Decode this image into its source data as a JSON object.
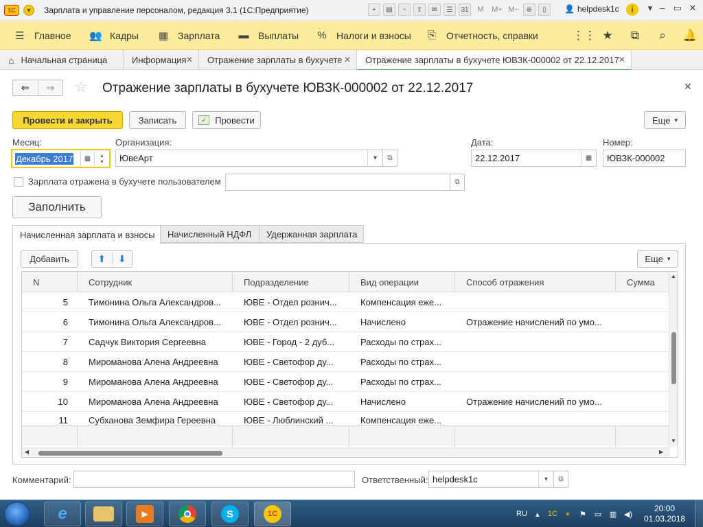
{
  "window": {
    "title": "Зарплата и управление персоналом, редакция 3.1 (1С:Предприятие)",
    "user": "helpdesk1c",
    "toolbar_text": [
      "M",
      "M+",
      "M−"
    ]
  },
  "sections": [
    {
      "label": "Главное",
      "icon": "hamburger-icon"
    },
    {
      "label": "Кадры",
      "icon": "people-icon"
    },
    {
      "label": "Зарплата",
      "icon": "calculator-icon"
    },
    {
      "label": "Выплаты",
      "icon": "wallet-icon"
    },
    {
      "label": "Налоги и взносы",
      "icon": "percent-icon"
    },
    {
      "label": "Отчетность, справки",
      "icon": "report-icon"
    }
  ],
  "open_tabs": [
    {
      "label": "Начальная страница",
      "icon": "home-icon"
    },
    {
      "label": "Информация"
    },
    {
      "label": "Отражение зарплаты в бухучете"
    },
    {
      "label": "Отражение зарплаты в бухучете ЮВЗК-000002 от 22.12.2017"
    }
  ],
  "document": {
    "title": "Отражение зарплаты в бухучете ЮВЗК-000002 от 22.12.2017",
    "buttons": {
      "post_close": "Провести и закрыть",
      "save": "Записать",
      "post": "Провести",
      "more": "Еще",
      "fill": "Заполнить"
    },
    "fields": {
      "month_label": "Месяц:",
      "month_value": "Декабрь 2017",
      "org_label": "Организация:",
      "org_value": "ЮвеАрт",
      "date_label": "Дата:",
      "date_value": "22.12.2017",
      "number_label": "Номер:",
      "number_value": "ЮВЗК-000002",
      "reflected_label": "Зарплата отражена в бухучете пользователем",
      "comment_label": "Комментарий:",
      "comment_value": "",
      "responsible_label": "Ответственный:",
      "responsible_value": "helpdesk1c"
    },
    "inner_tabs": [
      "Начисленная зарплата и взносы",
      "Начисленный НДФЛ",
      "Удержанная зарплата"
    ],
    "table_toolbar": {
      "add": "Добавить",
      "more": "Еще"
    },
    "table": {
      "columns": [
        "N",
        "Сотрудник",
        "Подразделение",
        "Вид операции",
        "Способ отражения",
        "Сумма"
      ],
      "rows": [
        {
          "n": "5",
          "employee": "Тимонина Ольга Александров...",
          "dept": "ЮВЕ - Отдел рознич...",
          "op": "Компенсация еже...",
          "method": ""
        },
        {
          "n": "6",
          "employee": "Тимонина Ольга Александров...",
          "dept": "ЮВЕ - Отдел рознич...",
          "op": "Начислено",
          "method": "Отражение начислений по умо..."
        },
        {
          "n": "7",
          "employee": "Садчук Виктория Сергеевна",
          "dept": "ЮВЕ - Город - 2 дуб...",
          "op": "Расходы по страх...",
          "method": ""
        },
        {
          "n": "8",
          "employee": "Мироманова Алена Андреевна",
          "dept": "ЮВЕ - Светофор ду...",
          "op": "Расходы по страх...",
          "method": ""
        },
        {
          "n": "9",
          "employee": "Мироманова Алена Андреевна",
          "dept": "ЮВЕ - Светофор ду...",
          "op": "Расходы по страх...",
          "method": ""
        },
        {
          "n": "10",
          "employee": "Мироманова Алена Андреевна",
          "dept": "ЮВЕ - Светофор ду...",
          "op": "Начислено",
          "method": "Отражение начислений по умо..."
        },
        {
          "n": "11",
          "employee": "Субханова Земфира Гереевна",
          "dept": "ЮВЕ - Люблинский ...",
          "op": "Компенсация еже...",
          "method": ""
        }
      ]
    }
  },
  "taskbar": {
    "lang": "RU",
    "time": "20:00",
    "date": "01.03.2018"
  },
  "colors": {
    "section_bar": "#fbec9c",
    "primary_button": "#f7d731",
    "active_tab_underline": "#4caf50"
  }
}
